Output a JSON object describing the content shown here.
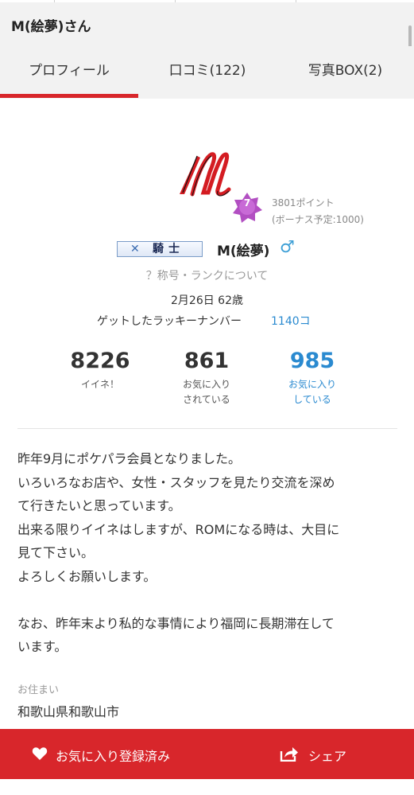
{
  "header": {
    "title": "M(絵夢)さん"
  },
  "tabs": [
    {
      "label": "プロフィール",
      "active": true
    },
    {
      "label": "口コミ(122)"
    },
    {
      "label": "写真BOX(2)"
    }
  ],
  "profile": {
    "rank_number": "7",
    "points": "3801ポイント",
    "bonus": "(ボーナス予定:1000)",
    "title_badge": "騎士",
    "username": "M(絵夢)",
    "gender_symbol": "♂",
    "rank_link": "？称号・ランクについて",
    "birthday_age": "2月26日 62歳",
    "lucky_label": "ゲットしたラッキーナンバー",
    "lucky_count": "1140コ"
  },
  "stats": [
    {
      "value": "8226",
      "label_line1": "イイネ！",
      "label_line2": ""
    },
    {
      "value": "861",
      "label_line1": "お気に入り",
      "label_line2": "されている"
    },
    {
      "value": "985",
      "label_line1": "お気に入り",
      "label_line2": "している"
    }
  ],
  "bio": "昨年9月にポケパラ会員となりました。\nいろいろなお店や、女性・スタッフを見たり交流を深め\nて行きたいと思っています。\n出来る限りイイネはしますが、ROMになる時は、大目に\n見て下さい。\nよろしくお願いします。\n\nなお、昨年末より私的な事情により福岡に長期滞在して\nいます。",
  "residence": {
    "label": "お住まい",
    "value": "和歌山県和歌山市"
  },
  "footer": {
    "favorite_label": "お気に入り登録済み",
    "share_label": "シェア"
  },
  "colors": {
    "accent_red": "#d8262b",
    "link_blue": "#2a8ad0",
    "badge_purple": "#b24fc2"
  },
  "icons": {
    "favorite": "heart-icon",
    "share": "share-icon",
    "gender": "male-icon",
    "title": "crossed-swords-icon"
  }
}
